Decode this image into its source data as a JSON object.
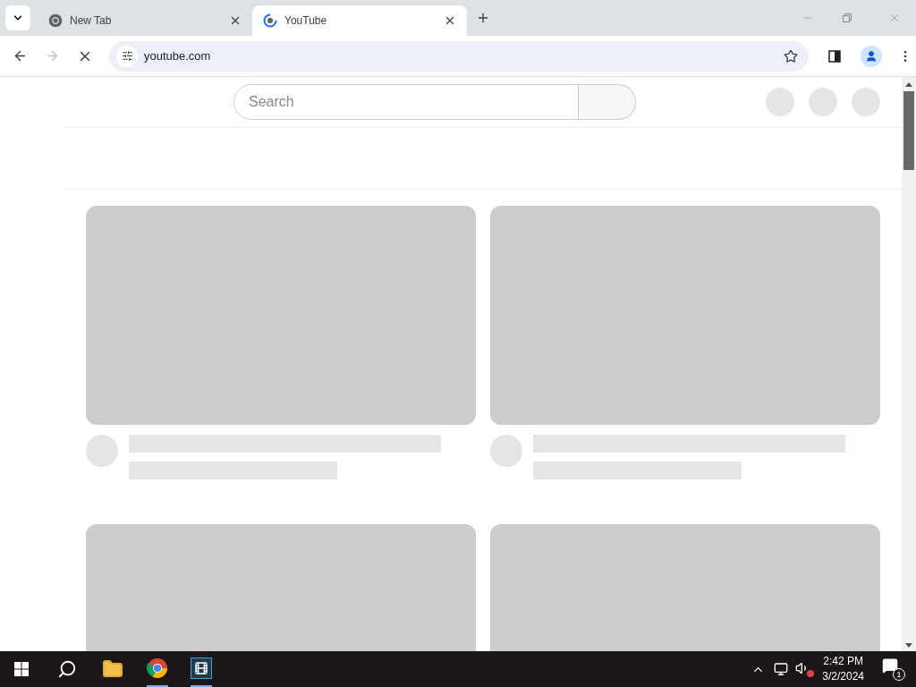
{
  "tabs": [
    {
      "title": "New Tab",
      "selected": false,
      "kind": "chrome"
    },
    {
      "title": "YouTube",
      "selected": true,
      "kind": "loading"
    }
  ],
  "toolbar": {
    "forward_disabled": true,
    "loading": true,
    "address": "youtube.com",
    "bookmarked": false
  },
  "page": {
    "search": {
      "placeholder": "Search"
    }
  },
  "taskbar": {
    "time": "2:42 PM",
    "date": "3/2/2024",
    "notifications": "1",
    "sound_muted": true
  }
}
